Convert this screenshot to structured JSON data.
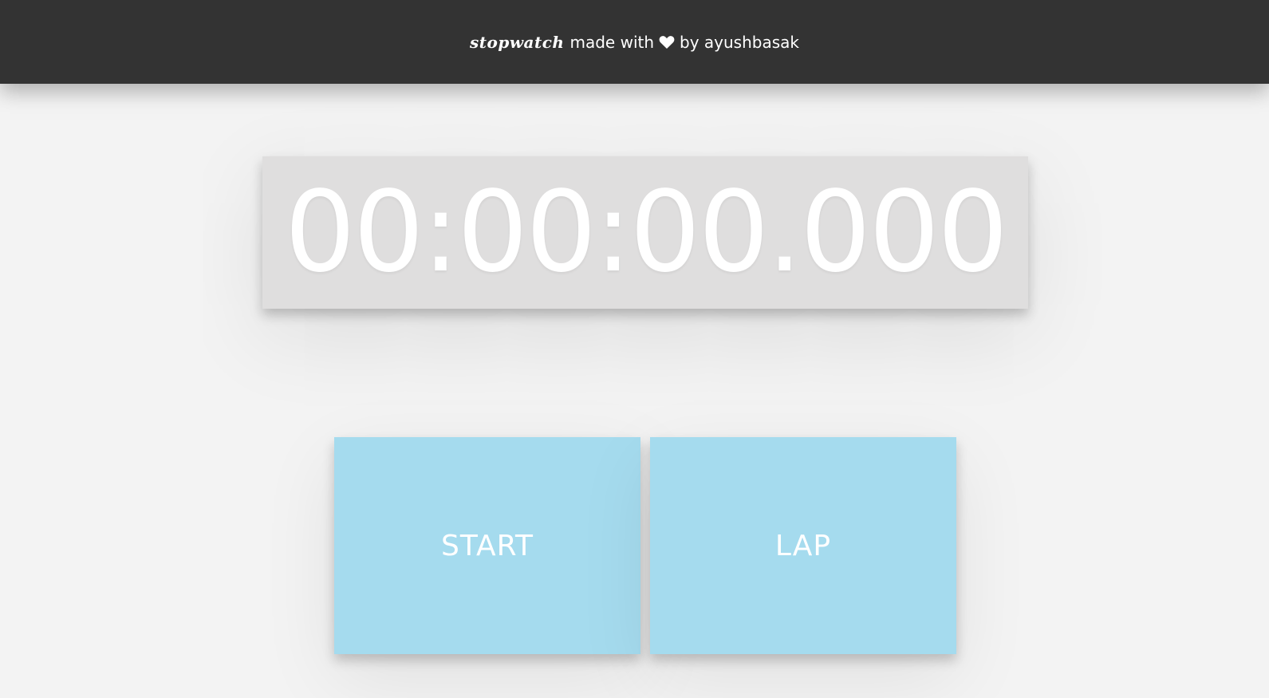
{
  "header": {
    "brand": "stopwatch",
    "made_with": "made with",
    "by_text": "by ayushbasak",
    "heart_icon": "heart-icon"
  },
  "stopwatch": {
    "time": "00:00:00.000"
  },
  "controls": {
    "start_label": "START",
    "lap_label": "LAP"
  },
  "colors": {
    "header_bg": "#333333",
    "page_bg": "#f3f3f3",
    "display_bg": "#dfdede",
    "button_bg": "#a5dbee",
    "text": "#ffffff"
  }
}
